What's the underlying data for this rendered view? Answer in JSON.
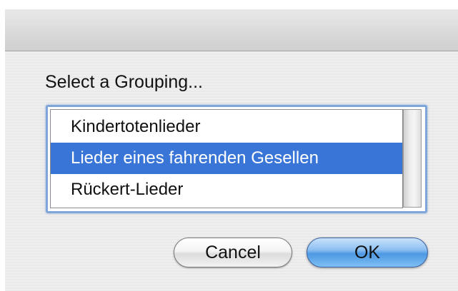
{
  "dialog": {
    "prompt": "Select a Grouping...",
    "list": {
      "items": [
        {
          "label": "Kindertotenlieder",
          "selected": false
        },
        {
          "label": "Lieder eines fahrenden Gesellen",
          "selected": true
        },
        {
          "label": "Rückert-Lieder",
          "selected": false
        }
      ],
      "selection_color": "#3875d7",
      "focus_ring_color": "#7ea6d9"
    },
    "buttons": {
      "cancel_label": "Cancel",
      "ok_label": "OK"
    }
  }
}
